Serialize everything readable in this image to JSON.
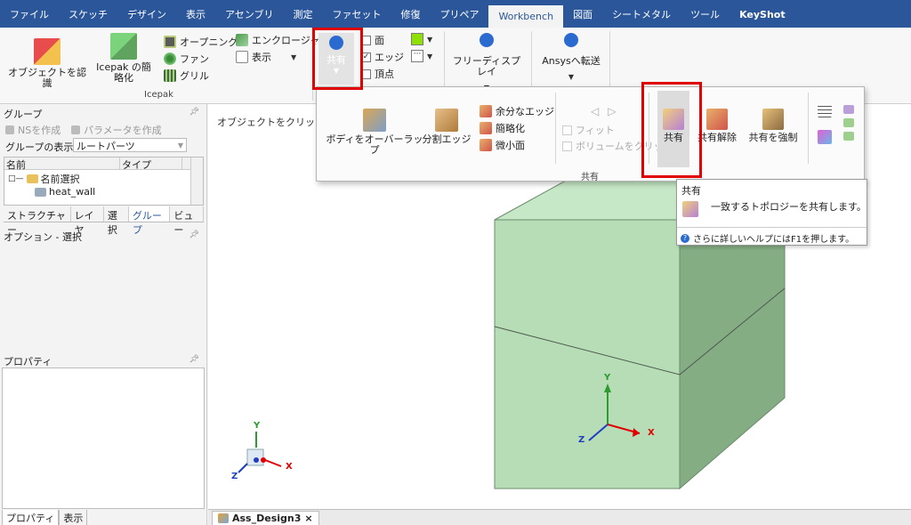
{
  "menu": {
    "tabs": [
      "ファイル",
      "スケッチ",
      "デザイン",
      "表示",
      "アセンブリ",
      "測定",
      "ファセット",
      "修復",
      "プリペア",
      "Workbench",
      "図面",
      "シートメタル",
      "ツール",
      "KeyShot"
    ],
    "active": "Workbench"
  },
  "ribbon": {
    "recognize": "オブジェクトを認識",
    "icepak_simplify": "Icepak の簡略化",
    "opening": "オープニング",
    "fan": "ファン",
    "grille": "グリル",
    "enclosure": "エンクロージャ",
    "display": "表示",
    "icepak_group": "Icepak",
    "share": "共有",
    "face": "面",
    "edge": "エッジ",
    "vertex": "頂点",
    "free_display": "フリーディスプレイ",
    "ansys_transfer": "Ansysへ転送"
  },
  "dropdown": {
    "body_overlap": "ボディをオーバーラップ",
    "split_edge": "分割エッジ",
    "extra_edge": "余分なエッジ",
    "simplify": "簡略化",
    "small_face": "微小面",
    "fit": "フィット",
    "volume_click": "ボリュームをクリップ",
    "share": "共有",
    "unshare": "共有解除",
    "force_share": "共有を強制",
    "group_label": "共有"
  },
  "tooltip": {
    "title": "共有",
    "desc": "一致するトポロジーを共有します。",
    "help": "さらに詳しいヘルプにはF1を押します。"
  },
  "left": {
    "group_title": "グループ",
    "ns_create": "NSを作成",
    "param_create": "パラメータを作成",
    "group_display_label": "グループの表示:",
    "group_display_value": "ルートパーツ",
    "col_name": "名前",
    "col_type": "タイプ",
    "tree_root": "名前選択",
    "tree_child": "heat_wall",
    "tabs": [
      "ストラクチャー",
      "レイヤ",
      "選択",
      "グループ",
      "ビュー"
    ],
    "active_tab": "グループ",
    "options_title": "オプション - 選択",
    "props_title": "プロパティ",
    "bottom_tabs": [
      "プロパティ",
      "表示"
    ]
  },
  "viewport": {
    "hint": "オブジェクトをクリックしま",
    "axis_x": "X",
    "axis_y": "Y",
    "axis_z": "Z"
  },
  "doc": {
    "tab": "Ass_Design3",
    "close": "×"
  },
  "colors": {
    "accent": "#2b579a",
    "box_front": "#b7ddb7",
    "box_side": "#7fa97f",
    "box_top": "#c6e8c6",
    "highlight": "#e00000"
  }
}
